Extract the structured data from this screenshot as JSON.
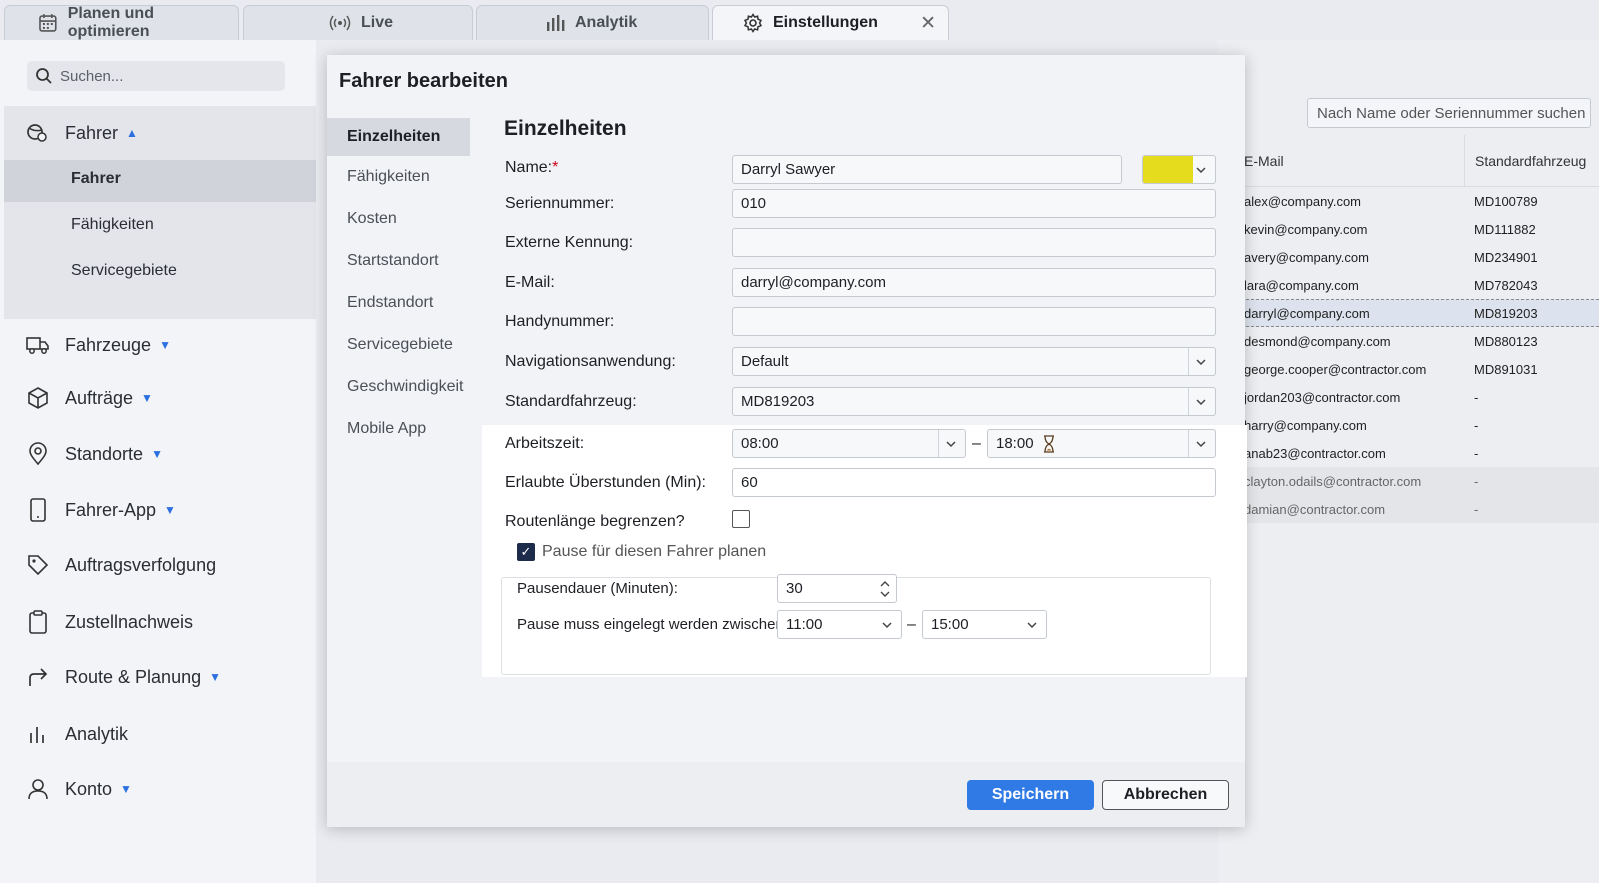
{
  "tabs": [
    {
      "label": "Planen und optimieren",
      "icon": "calendar-icon"
    },
    {
      "label": "Live",
      "icon": "broadcast-icon"
    },
    {
      "label": "Analytik",
      "icon": "bar-chart-icon"
    },
    {
      "label": "Einstellungen",
      "icon": "gear-icon",
      "close": "✕"
    }
  ],
  "sidebar": {
    "search_placeholder": "Suchen...",
    "fahrer": {
      "label": "Fahrer",
      "subitems": [
        "Fahrer",
        "Fähigkeiten",
        "Servicegebiete"
      ]
    },
    "items": [
      {
        "label": "Fahrzeuge",
        "icon": "truck-icon"
      },
      {
        "label": "Aufträge",
        "icon": "box-icon"
      },
      {
        "label": "Standorte",
        "icon": "map-pin-icon"
      },
      {
        "label": "Fahrer-App",
        "icon": "phone-icon"
      },
      {
        "label": "Auftragsverfolgung",
        "icon": "tag-icon"
      },
      {
        "label": "Zustellnachweis",
        "icon": "clipboard-icon"
      },
      {
        "label": "Route & Planung",
        "icon": "route-icon"
      },
      {
        "label": "Analytik",
        "icon": "analytics-icon"
      },
      {
        "label": "Konto",
        "icon": "user-icon"
      }
    ]
  },
  "right": {
    "search_placeholder": "Nach Name oder Seriennummer suchen",
    "col_email": "E-Mail",
    "col_vehicle": "Standardfahrzeug",
    "rows": [
      [
        "alex@company.com",
        "MD100789"
      ],
      [
        "kevin@company.com",
        "MD111882"
      ],
      [
        "avery@company.com",
        "MD234901"
      ],
      [
        "lara@company.com",
        "MD782043"
      ],
      [
        "darryl@company.com",
        "MD819203"
      ],
      [
        "desmond@company.com",
        "MD880123"
      ],
      [
        "george.cooper@contractor.com",
        "MD891031"
      ],
      [
        "jordan203@contractor.com",
        "-"
      ],
      [
        "harry@company.com",
        "-"
      ],
      [
        "anab23@contractor.com",
        "-"
      ],
      [
        "clayton.odails@contractor.com",
        "-"
      ],
      [
        "damian@contractor.com",
        "-"
      ]
    ]
  },
  "modal": {
    "title": "Fahrer bearbeiten",
    "nav": [
      "Einzelheiten",
      "Fähigkeiten",
      "Kosten",
      "Startstandort",
      "Endstandort",
      "Servicegebiete",
      "Geschwindigkeit",
      "Mobile App"
    ],
    "section": "Einzelheiten",
    "labels": {
      "name": "Name:",
      "name_req": "*",
      "serial": "Seriennummer:",
      "external": "Externe Kennung:",
      "email": "E-Mail:",
      "mobile": "Handynummer:",
      "nav_app": "Navigationsanwendung:",
      "vehicle": "Standardfahrzeug:",
      "worktime": "Arbeitszeit:",
      "overtime": "Erlaubte Überstunden (Min):",
      "limit_route": "Routenlänge begrenzen?",
      "plan_break": "Pause für diesen Fahrer planen",
      "break_duration": "Pausendauer (Minuten):",
      "break_between": "Pause muss eingelegt werden zwischen:"
    },
    "values": {
      "name": "Darryl Sawyer",
      "color": "#e6dc1e",
      "serial": "010",
      "external": "",
      "email": "darryl@company.com",
      "mobile": "",
      "nav_app": "Default",
      "vehicle": "MD819203",
      "work_start": "08:00",
      "work_end": "18:00",
      "dash": "–",
      "overtime": "60",
      "break_duration": "30",
      "break_start": "11:00",
      "break_end": "15:00"
    },
    "save": "Speichern",
    "cancel": "Abbrechen"
  }
}
